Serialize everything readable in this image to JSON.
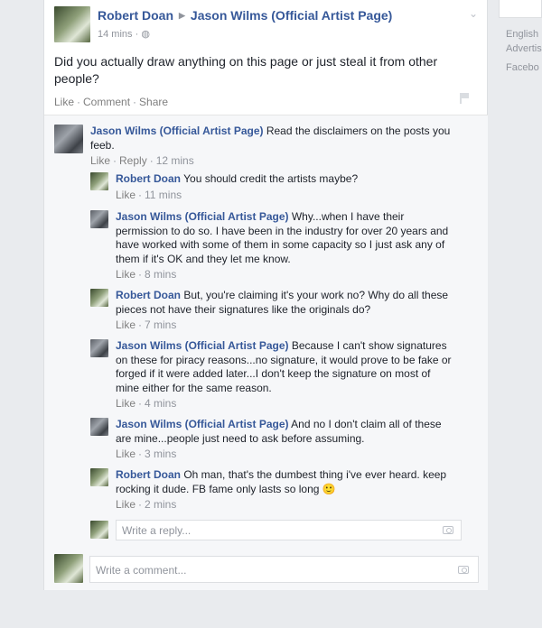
{
  "post": {
    "author": "Robert Doan",
    "target": "Jason Wilms (Official Artist Page)",
    "time": "14 mins",
    "text": "Did you actually draw anything on this page or just steal it from other people?",
    "like": "Like",
    "comment": "Comment",
    "share": "Share"
  },
  "comments": [
    {
      "author": "Jason Wilms (Official Artist Page)",
      "text": "Read the disclaimers on the posts you feeb.",
      "like": "Like",
      "reply": "Reply",
      "time": "12 mins"
    },
    {
      "author": "Robert Doan",
      "text": "You should credit the artists maybe?",
      "like": "Like",
      "time": "11 mins"
    },
    {
      "author": "Jason Wilms (Official Artist Page)",
      "text": "Why...when I have their permission to do so. I have been in the industry for over 20 years and have worked with some of them in some capacity so I just ask any of them if it's OK and they let me know.",
      "like": "Like",
      "time": "8 mins"
    },
    {
      "author": "Robert Doan",
      "text": "But, you're claiming it's your work no? Why do all these pieces not have their signatures like the originals do?",
      "like": "Like",
      "time": "7 mins"
    },
    {
      "author": "Jason Wilms (Official Artist Page)",
      "text": "Because I can't show signatures on these for piracy reasons...no signature, it would prove to be fake or forged if it were added later...I don't keep the signature on most of mine either for the same reason.",
      "like": "Like",
      "time": "4 mins"
    },
    {
      "author": "Jason Wilms (Official Artist Page)",
      "text": "And no I don't claim all of these are mine...people just need to ask before assuming.",
      "like": "Like",
      "time": "3 mins"
    },
    {
      "author": "Robert Doan",
      "text": "Oh man, that's the dumbest thing i've ever heard. keep rocking it dude. FB fame only lasts so long",
      "emoji": "🙂",
      "like": "Like",
      "time": "2 mins"
    }
  ],
  "reply_placeholder": "Write a reply...",
  "comment_placeholder": "Write a comment...",
  "sidebar": {
    "line1": "English",
    "line2": "Advertis",
    "line3": "Facebo"
  },
  "colors": {
    "link_blue": "#365899",
    "meta_gray": "#90949c",
    "background": "#e9ebee"
  }
}
